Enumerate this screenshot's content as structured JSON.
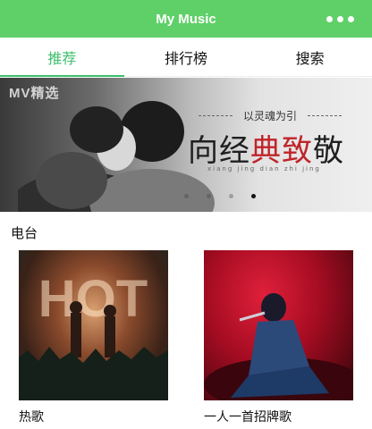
{
  "app": {
    "title": "My Music"
  },
  "tabs": [
    {
      "label": "推荐",
      "active": true
    },
    {
      "label": "排行榜",
      "active": false
    },
    {
      "label": "搜索",
      "active": false
    }
  ],
  "banner": {
    "watermark": "MV精选",
    "subtitle": "以灵魂为引",
    "title_part1": "向经",
    "title_part2": "典致",
    "title_part3": "敬",
    "pinyin": "xiang jing dian zhi jing",
    "slide_count": 4,
    "active_slide": 4
  },
  "radio": {
    "heading": "电台",
    "items": [
      {
        "label": "热歌",
        "thumb_text": "HOT"
      },
      {
        "label": "一人一首招牌歌"
      }
    ]
  },
  "colors": {
    "accent": "#5fcf67",
    "tab_active": "#3dbf6c",
    "banner_red": "#c0242a"
  }
}
